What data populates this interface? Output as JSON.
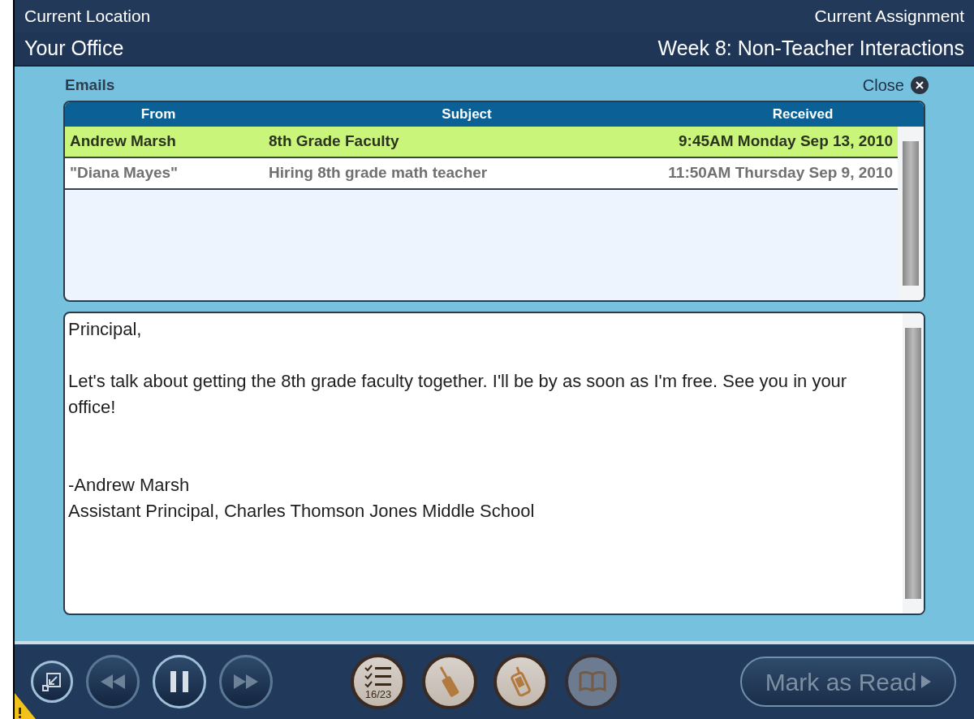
{
  "header": {
    "location_label": "Current Location",
    "location": "Your Office",
    "assignment_label": "Current Assignment",
    "assignment": "Week 8: Non-Teacher Interactions"
  },
  "panel": {
    "title": "Emails",
    "close": "Close"
  },
  "table": {
    "columns": [
      "From",
      "Subject",
      "Received"
    ],
    "rows": [
      {
        "from": "Andrew Marsh",
        "subject": "8th Grade Faculty",
        "received": "9:45AM Monday Sep 13, 2010",
        "selected": true
      },
      {
        "from": "\"Diana Mayes\"",
        "subject": "Hiring 8th grade math teacher",
        "received": "11:50AM Thursday Sep 9, 2010",
        "selected": false
      }
    ]
  },
  "message": {
    "greeting": "Principal,",
    "body": "Let's talk about getting the 8th grade faculty together. I'll be by as soon as I'm free. See you in your office!",
    "signature": "-Andrew Marsh\nAssistant Principal, Charles Thomson Jones Middle School"
  },
  "toolbar": {
    "media": [
      {
        "kind": "resize",
        "disabled": false
      },
      {
        "kind": "rewind",
        "disabled": true
      },
      {
        "kind": "pause",
        "disabled": false
      },
      {
        "kind": "forward",
        "disabled": true
      }
    ],
    "tools": [
      {
        "kind": "checklist",
        "count": "16/23",
        "disabled": false
      },
      {
        "kind": "radio",
        "disabled": false
      },
      {
        "kind": "phone",
        "disabled": false
      },
      {
        "kind": "book",
        "disabled": true
      }
    ],
    "mark_read": {
      "label": "Mark as Read",
      "disabled": true
    }
  }
}
